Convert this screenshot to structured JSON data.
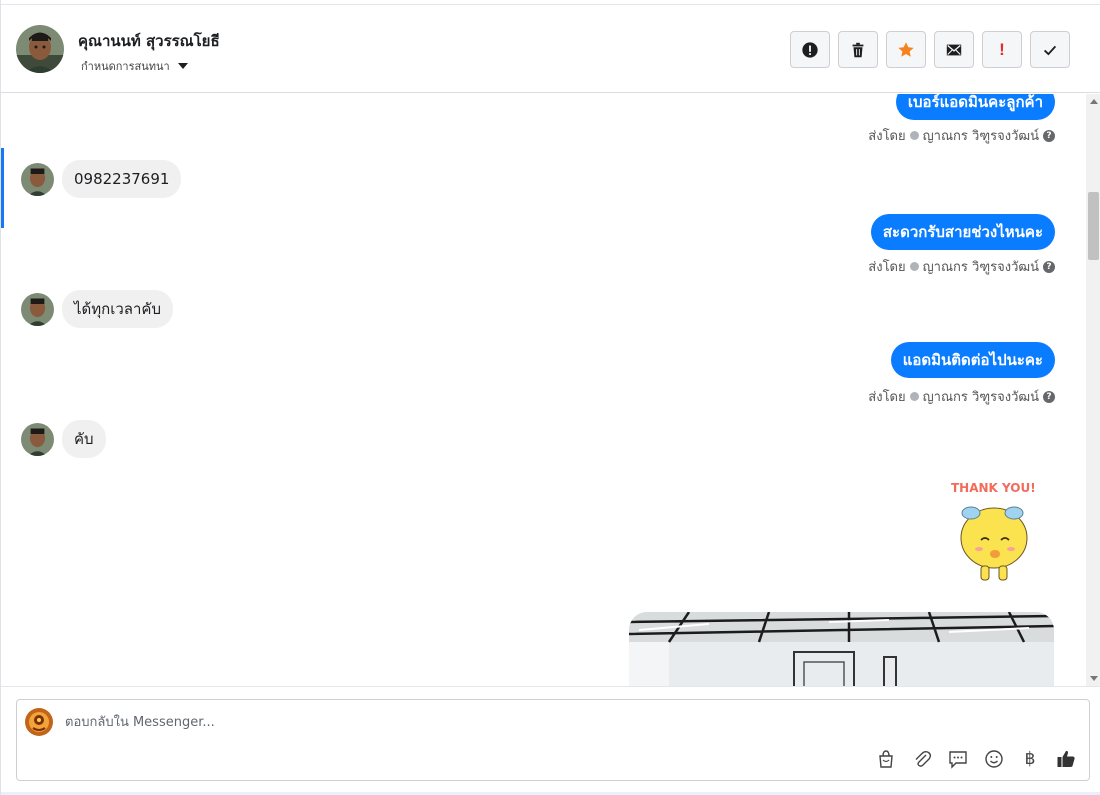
{
  "header": {
    "contact_name": "คุณานนท์ สุวรรณโยธี",
    "assign_label": "กำหนดการสนทนา"
  },
  "actions": [
    {
      "name": "report-spam-button",
      "icon": "alert-circle-icon"
    },
    {
      "name": "delete-button",
      "icon": "trash-icon"
    },
    {
      "name": "star-button",
      "icon": "star-icon"
    },
    {
      "name": "mark-unread-button",
      "icon": "envelope-icon"
    },
    {
      "name": "follow-up-button",
      "icon": "exclamation-icon",
      "text": "!"
    },
    {
      "name": "mark-done-button",
      "icon": "check-icon"
    }
  ],
  "messages": [
    {
      "dir": "out",
      "text": "เบอร์แอดมินคะลูกค้า"
    },
    {
      "dir": "sent_by",
      "prefix": "ส่งโดย",
      "agent": "ญาณกร วิฑูรจงวัฒน์"
    },
    {
      "dir": "in",
      "text": "0982237691"
    },
    {
      "dir": "out",
      "text": "สะดวกรับสายช่วงไหนคะ"
    },
    {
      "dir": "sent_by",
      "prefix": "ส่งโดย",
      "agent": "ญาณกร วิฑูรจงวัฒน์"
    },
    {
      "dir": "in",
      "text": "ได้ทุกเวลาคับ"
    },
    {
      "dir": "out",
      "text": "แอดมินติดต่อไปนะคะ"
    },
    {
      "dir": "sent_by",
      "prefix": "ส่งโดย",
      "agent": "ญาณกร วิฑูรจงวัฒน์"
    },
    {
      "dir": "in",
      "text": "คับ"
    }
  ],
  "sticker": {
    "text": "THANK YOU!"
  },
  "composer": {
    "placeholder": "ตอบกลับใน Messenger...",
    "tools": [
      "shopping-bag-icon",
      "paperclip-icon",
      "saved-reply-icon",
      "emoji-icon",
      "baht-icon",
      "thumbs-up-icon"
    ],
    "baht_symbol": "฿"
  },
  "colors": {
    "outgoing_bubble": "#0a7cff",
    "incoming_bubble": "#f0f0f0",
    "star": "#f5821f",
    "alert": "#e02d2d"
  }
}
